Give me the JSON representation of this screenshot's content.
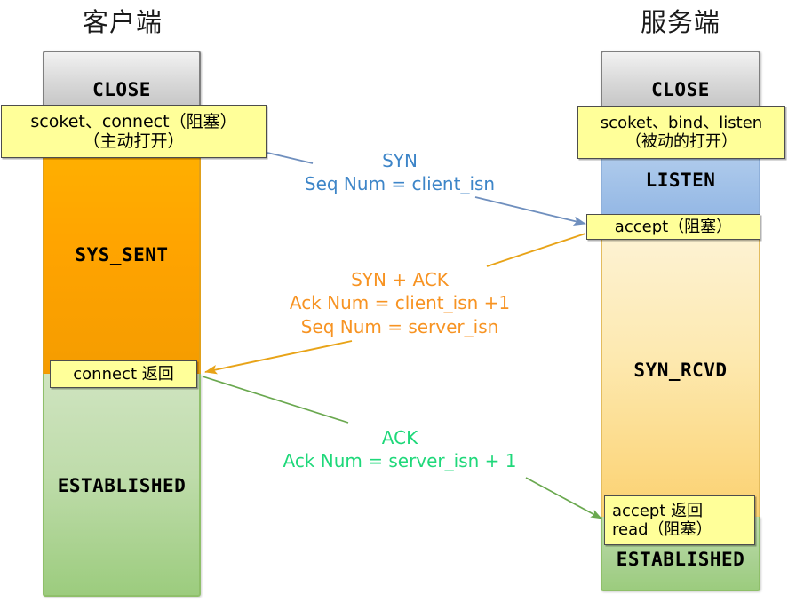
{
  "diagram": {
    "columns": {
      "client_title": "客户端",
      "server_title": "服务端"
    },
    "client": {
      "states": [
        {
          "name": "CLOSE",
          "label": "CLOSE",
          "color": "#d9d9d9"
        },
        {
          "name": "SYS_SENT",
          "label": "SYS_SENT",
          "color": "#ffa400"
        },
        {
          "name": "ESTABLISHED",
          "label": "ESTABLISHED",
          "color": "#9ccc7e"
        }
      ],
      "notes": [
        {
          "name": "socket-connect",
          "line1": "scoket、connect（阻塞）",
          "line2": "（主动打开）"
        },
        {
          "name": "connect-return",
          "line1": "connect 返回",
          "line2": ""
        }
      ]
    },
    "server": {
      "states": [
        {
          "name": "CLOSE",
          "label": "CLOSE",
          "color": "#d9d9d9"
        },
        {
          "name": "LISTEN",
          "label": "LISTEN",
          "color": "#a8c6ea"
        },
        {
          "name": "SYN_RCVD",
          "label": "SYN_RCVD",
          "color": "#fde9b0"
        },
        {
          "name": "ESTABLISHED",
          "label": "ESTABLISHED",
          "color": "#9ccc7e"
        }
      ],
      "notes": [
        {
          "name": "socket-bind-listen",
          "line1": "scoket、bind、listen",
          "line2": "（被动的打开）"
        },
        {
          "name": "accept-block",
          "line1": "accept（阻塞）",
          "line2": ""
        },
        {
          "name": "accept-return",
          "line1": "accept 返回",
          "line2": "read（阻塞）"
        }
      ]
    },
    "messages": [
      {
        "name": "syn",
        "color": "#3d85c8",
        "line1": "SYN",
        "line2": "Seq Num = client_isn",
        "line3": "",
        "direction": "client-to-server"
      },
      {
        "name": "syn-ack",
        "color": "#f79322",
        "line1": "SYN + ACK",
        "line2": "Ack Num =  client_isn +1",
        "line3": "Seq Num = server_isn",
        "direction": "server-to-client"
      },
      {
        "name": "ack",
        "color": "#1fd87a",
        "line1": "ACK",
        "line2": "Ack Num = server_isn + 1",
        "line3": "",
        "direction": "client-to-server"
      }
    ]
  }
}
